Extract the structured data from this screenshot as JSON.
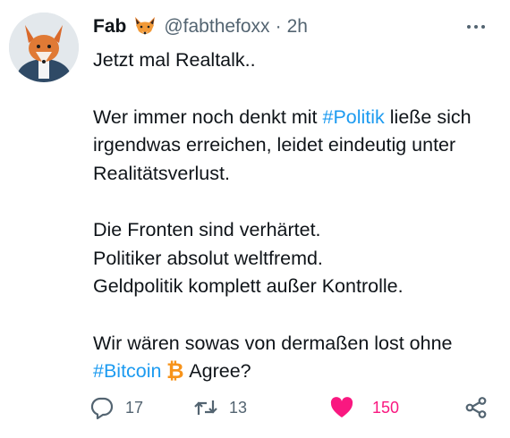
{
  "author": {
    "name": "Fab",
    "badge_icon": "fox-face-icon",
    "handle": "@fabthefoxx",
    "separator": "·",
    "time": "2h"
  },
  "tweet": {
    "line1": "Jetzt mal Realtalk..",
    "para2_before": "Wer immer noch denkt mit ",
    "hashtag_politik": "#Politik",
    "para2_after": " ließe sich irgendwas erreichen, leidet eindeutig unter Realitätsverlust.",
    "line_fronten": "Die Fronten sind verhärtet.",
    "line_politiker": "Politiker absolut weltfremd.",
    "line_geld": "Geldpolitik komplett außer Kontrolle.",
    "para4_before": "Wir wären sowas von dermaßen lost ohne ",
    "hashtag_bitcoin": "#Bitcoin",
    "bitcoin_icon": "bitcoin-icon",
    "para4_after": " Agree?"
  },
  "actions": {
    "reply_count": "17",
    "retweet_count": "13",
    "like_count": "150",
    "liked": true,
    "like_color": "#f91880"
  },
  "colors": {
    "text": "#0f1419",
    "secondary": "#536471",
    "link": "#1d9bf0",
    "bitcoin": "#f7931a"
  }
}
